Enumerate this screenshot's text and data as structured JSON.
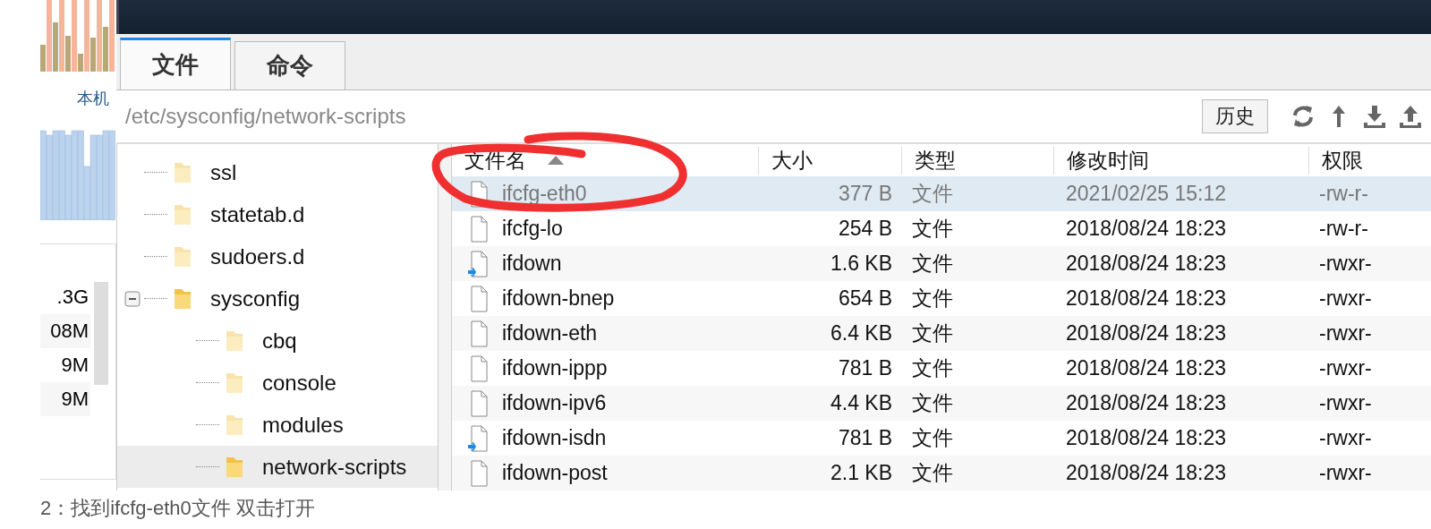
{
  "side_panel": {
    "label": "本机",
    "values": [
      ".3G",
      "08M",
      "9M",
      "9M"
    ]
  },
  "tabs": [
    {
      "label": "文件",
      "selected": true
    },
    {
      "label": "命令",
      "selected": false
    }
  ],
  "path_bar": {
    "path": "/etc/sysconfig/network-scripts",
    "history_button": "历史"
  },
  "tree": [
    {
      "name": "ssl",
      "selected": false
    },
    {
      "name": "statetab.d",
      "selected": false
    },
    {
      "name": "sudoers.d",
      "selected": false
    },
    {
      "name": "sysconfig",
      "selected": false,
      "expanded": true,
      "children": [
        {
          "name": "cbq",
          "selected": false
        },
        {
          "name": "console",
          "selected": false
        },
        {
          "name": "modules",
          "selected": false
        },
        {
          "name": "network-scripts",
          "selected": true
        }
      ]
    }
  ],
  "table": {
    "columns": [
      "文件名",
      "大小",
      "类型",
      "修改时间",
      "权限"
    ],
    "rows": [
      {
        "kind": "file",
        "selected": true,
        "name": "ifcfg-eth0",
        "size": "377 B",
        "type": "文件",
        "modified": "2021/02/25 15:12",
        "permissions": "-rw-r-"
      },
      {
        "kind": "file",
        "selected": false,
        "name": "ifcfg-lo",
        "size": "254 B",
        "type": "文件",
        "modified": "2018/08/24 18:23",
        "permissions": "-rw-r-"
      },
      {
        "kind": "link",
        "selected": false,
        "name": "ifdown",
        "size": "1.6 KB",
        "type": "文件",
        "modified": "2018/08/24 18:23",
        "permissions": "-rwxr-"
      },
      {
        "kind": "file",
        "selected": false,
        "name": "ifdown-bnep",
        "size": "654 B",
        "type": "文件",
        "modified": "2018/08/24 18:23",
        "permissions": "-rwxr-"
      },
      {
        "kind": "file",
        "selected": false,
        "name": "ifdown-eth",
        "size": "6.4 KB",
        "type": "文件",
        "modified": "2018/08/24 18:23",
        "permissions": "-rwxr-"
      },
      {
        "kind": "file",
        "selected": false,
        "name": "ifdown-ippp",
        "size": "781 B",
        "type": "文件",
        "modified": "2018/08/24 18:23",
        "permissions": "-rwxr-"
      },
      {
        "kind": "file",
        "selected": false,
        "name": "ifdown-ipv6",
        "size": "4.4 KB",
        "type": "文件",
        "modified": "2018/08/24 18:23",
        "permissions": "-rwxr-"
      },
      {
        "kind": "link",
        "selected": false,
        "name": "ifdown-isdn",
        "size": "781 B",
        "type": "文件",
        "modified": "2018/08/24 18:23",
        "permissions": "-rwxr-"
      },
      {
        "kind": "file",
        "selected": false,
        "name": "ifdown-post",
        "size": "2.1 KB",
        "type": "文件",
        "modified": "2018/08/24 18:23",
        "permissions": "-rwxr-"
      }
    ]
  },
  "caption": "2：找到ifcfg-eth0文件 双击打开"
}
